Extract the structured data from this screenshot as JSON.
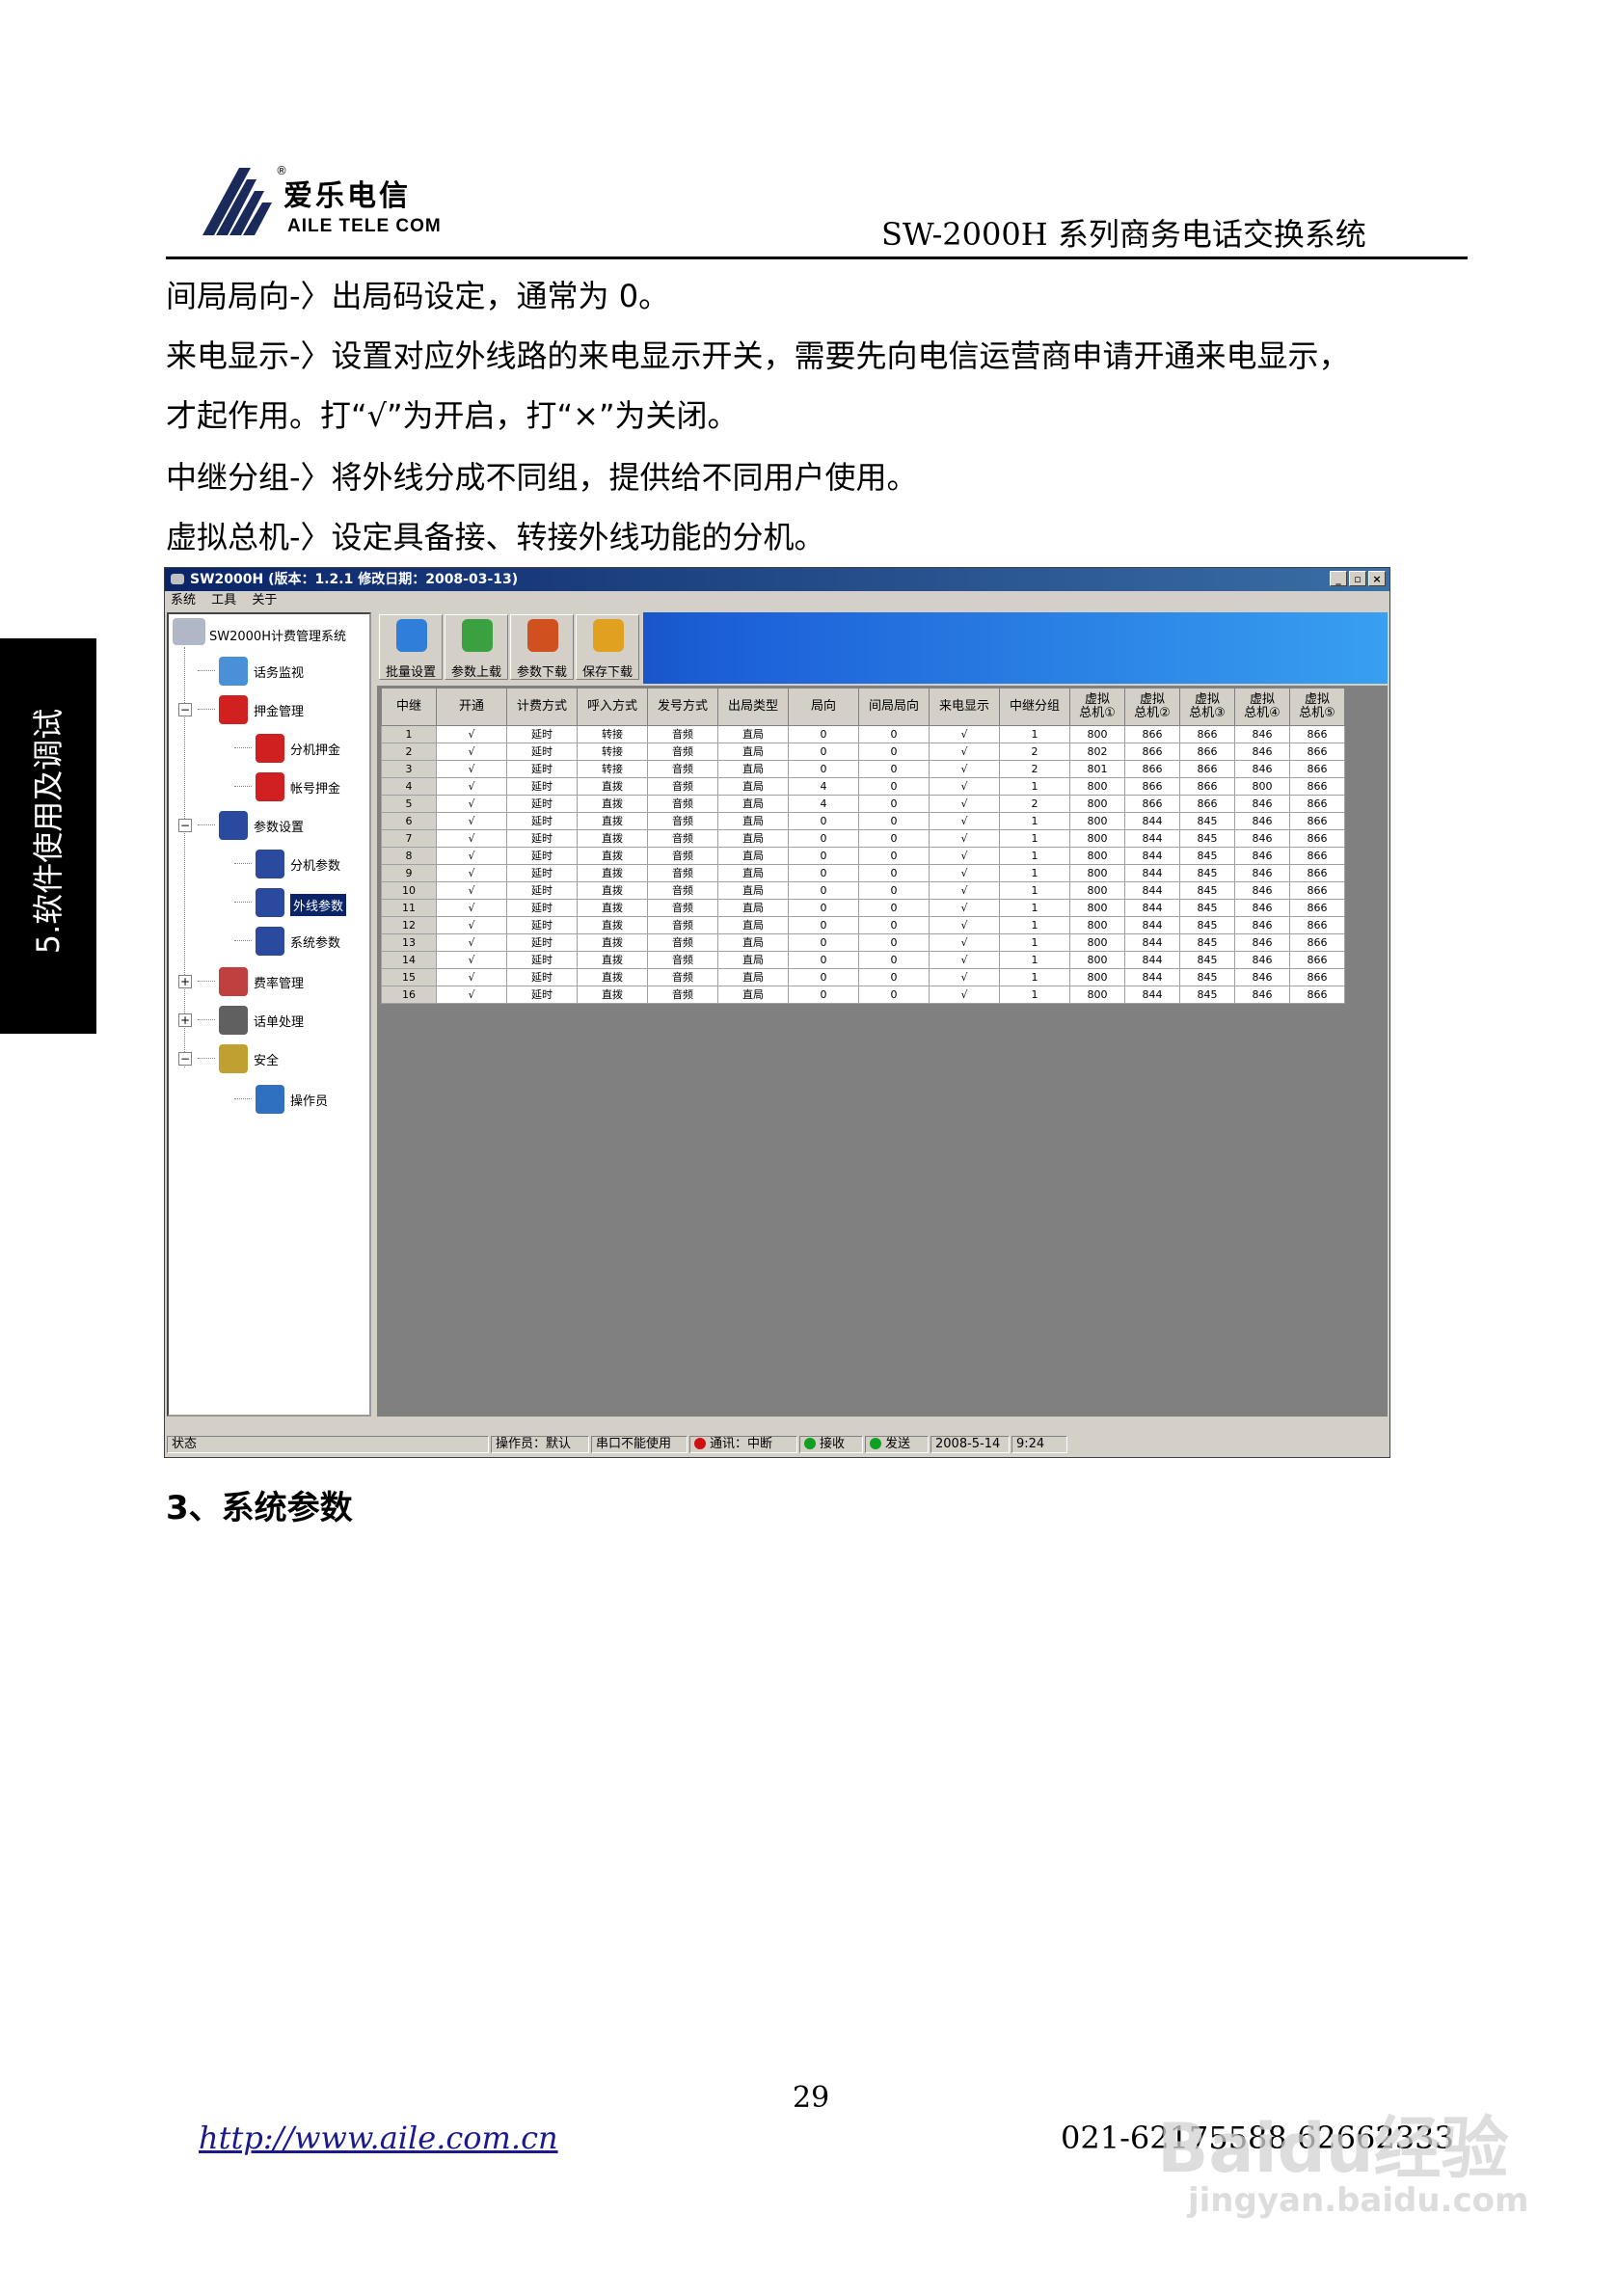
{
  "header": {
    "brand_cn": "爱乐电信",
    "brand_en": "AILE TELE COM",
    "reg_mark": "®",
    "doc_title": "SW-2000H 系列商务电话交换系统"
  },
  "side_tab": {
    "label": "5.软件使用及调试"
  },
  "paragraphs": [
    "间局局向-〉出局码设定，通常为 0。",
    "来电显示-〉设置对应外线路的来电显示开关，需要先向电信运营商申请开通来电显示，",
    "才起作用。打“√”为开启，打“×”为关闭。",
    "中继分组-〉将外线分成不同组，提供给不同用户使用。",
    "虚拟总机-〉设定具备接、转接外线功能的分机。"
  ],
  "window": {
    "title": "SW2000H (版本：1.2.1 修改日期：2008-03-13)",
    "controls": {
      "minimize": "_",
      "restore": "▫",
      "close": "×"
    },
    "menu": [
      "系统",
      "工具",
      "关于"
    ],
    "tree": {
      "root": "SW2000H计费管理系统",
      "nodes": [
        {
          "label": "话务监视",
          "icon": "monitor-icon",
          "color": "#4a90d9"
        },
        {
          "label": "押金管理",
          "icon": "hand-stop-icon",
          "color": "#d02020",
          "expander": "−"
        },
        {
          "label": "分机押金",
          "icon": "hand-stop-icon",
          "color": "#d02020"
        },
        {
          "label": "帐号押金",
          "icon": "hand-stop-icon",
          "color": "#d02020"
        },
        {
          "label": "参数设置",
          "icon": "params-icon",
          "color": "#2a4aa0",
          "expander": "−"
        },
        {
          "label": "分机参数",
          "icon": "params-icon",
          "color": "#2a4aa0"
        },
        {
          "label": "外线参数",
          "icon": "params-icon",
          "color": "#2a4aa0",
          "selected": true
        },
        {
          "label": "系统参数",
          "icon": "params-icon",
          "color": "#2a4aa0"
        },
        {
          "label": "费率管理",
          "icon": "tools-icon",
          "color": "#c04040",
          "expander": "+"
        },
        {
          "label": "话单处理",
          "icon": "film-reel-icon",
          "color": "#606060",
          "expander": "+"
        },
        {
          "label": "安全",
          "icon": "keys-icon",
          "color": "#c0a030",
          "expander": "−"
        },
        {
          "label": "操作员",
          "icon": "users-icon",
          "color": "#3070c0"
        }
      ]
    },
    "toolbar": [
      {
        "label": "批量设置",
        "icon": "gear-icon",
        "color": "#2f7fd8"
      },
      {
        "label": "参数上载",
        "icon": "upload-icon",
        "color": "#3aa040"
      },
      {
        "label": "参数下载",
        "icon": "download-icon",
        "color": "#d05020"
      },
      {
        "label": "保存下载",
        "icon": "save-icon",
        "color": "#e0a020"
      }
    ],
    "table": {
      "headers": [
        "中继",
        "开通",
        "计费方式",
        "呼入方式",
        "发号方式",
        "出局类型",
        "局向",
        "间局局向",
        "来电显示",
        "中继分组",
        "虚拟\n总机①",
        "虚拟\n总机②",
        "虚拟\n总机③",
        "虚拟\n总机④",
        "虚拟\n总机⑤"
      ],
      "rows": [
        [
          "1",
          "√",
          "延时",
          "转接",
          "音频",
          "直局",
          "0",
          "0",
          "√",
          "1",
          "800",
          "866",
          "866",
          "846",
          "866"
        ],
        [
          "2",
          "√",
          "延时",
          "转接",
          "音频",
          "直局",
          "0",
          "0",
          "√",
          "2",
          "802",
          "866",
          "866",
          "846",
          "866"
        ],
        [
          "3",
          "√",
          "延时",
          "转接",
          "音频",
          "直局",
          "0",
          "0",
          "√",
          "2",
          "801",
          "866",
          "866",
          "846",
          "866"
        ],
        [
          "4",
          "√",
          "延时",
          "直拨",
          "音频",
          "直局",
          "4",
          "0",
          "√",
          "1",
          "800",
          "866",
          "866",
          "800",
          "866"
        ],
        [
          "5",
          "√",
          "延时",
          "直拨",
          "音频",
          "直局",
          "4",
          "0",
          "√",
          "2",
          "800",
          "866",
          "866",
          "846",
          "866"
        ],
        [
          "6",
          "√",
          "延时",
          "直拨",
          "音频",
          "直局",
          "0",
          "0",
          "√",
          "1",
          "800",
          "844",
          "845",
          "846",
          "866"
        ],
        [
          "7",
          "√",
          "延时",
          "直拨",
          "音频",
          "直局",
          "0",
          "0",
          "√",
          "1",
          "800",
          "844",
          "845",
          "846",
          "866"
        ],
        [
          "8",
          "√",
          "延时",
          "直拨",
          "音频",
          "直局",
          "0",
          "0",
          "√",
          "1",
          "800",
          "844",
          "845",
          "846",
          "866"
        ],
        [
          "9",
          "√",
          "延时",
          "直拨",
          "音频",
          "直局",
          "0",
          "0",
          "√",
          "1",
          "800",
          "844",
          "845",
          "846",
          "866"
        ],
        [
          "10",
          "√",
          "延时",
          "直拨",
          "音频",
          "直局",
          "0",
          "0",
          "√",
          "1",
          "800",
          "844",
          "845",
          "846",
          "866"
        ],
        [
          "11",
          "√",
          "延时",
          "直拨",
          "音频",
          "直局",
          "0",
          "0",
          "√",
          "1",
          "800",
          "844",
          "845",
          "846",
          "866"
        ],
        [
          "12",
          "√",
          "延时",
          "直拨",
          "音频",
          "直局",
          "0",
          "0",
          "√",
          "1",
          "800",
          "844",
          "845",
          "846",
          "866"
        ],
        [
          "13",
          "√",
          "延时",
          "直拨",
          "音频",
          "直局",
          "0",
          "0",
          "√",
          "1",
          "800",
          "844",
          "845",
          "846",
          "866"
        ],
        [
          "14",
          "√",
          "延时",
          "直拨",
          "音频",
          "直局",
          "0",
          "0",
          "√",
          "1",
          "800",
          "844",
          "845",
          "846",
          "866"
        ],
        [
          "15",
          "√",
          "延时",
          "直拨",
          "音频",
          "直局",
          "0",
          "0",
          "√",
          "1",
          "800",
          "844",
          "845",
          "846",
          "866"
        ],
        [
          "16",
          "√",
          "延时",
          "直拨",
          "音频",
          "直局",
          "0",
          "0",
          "√",
          "1",
          "800",
          "844",
          "845",
          "846",
          "866"
        ]
      ]
    },
    "status": {
      "state": "状态",
      "operator": "操作员：默认",
      "serial": "串口不能使用",
      "comm": "通讯：中断",
      "recv": "接收",
      "send": "发送",
      "date": "2008-5-14",
      "time": "9:24",
      "colors": {
        "comm": "#d01010",
        "recv": "#10a020",
        "send": "#10a020"
      }
    }
  },
  "section_heading": "3、系统参数",
  "footer": {
    "page_number": "29",
    "url": "http://www.aile.com.cn",
    "phone": "021-62175588    62662333"
  },
  "watermark": {
    "main": "Baidu经验",
    "sub": "jingyan.baidu.com"
  }
}
